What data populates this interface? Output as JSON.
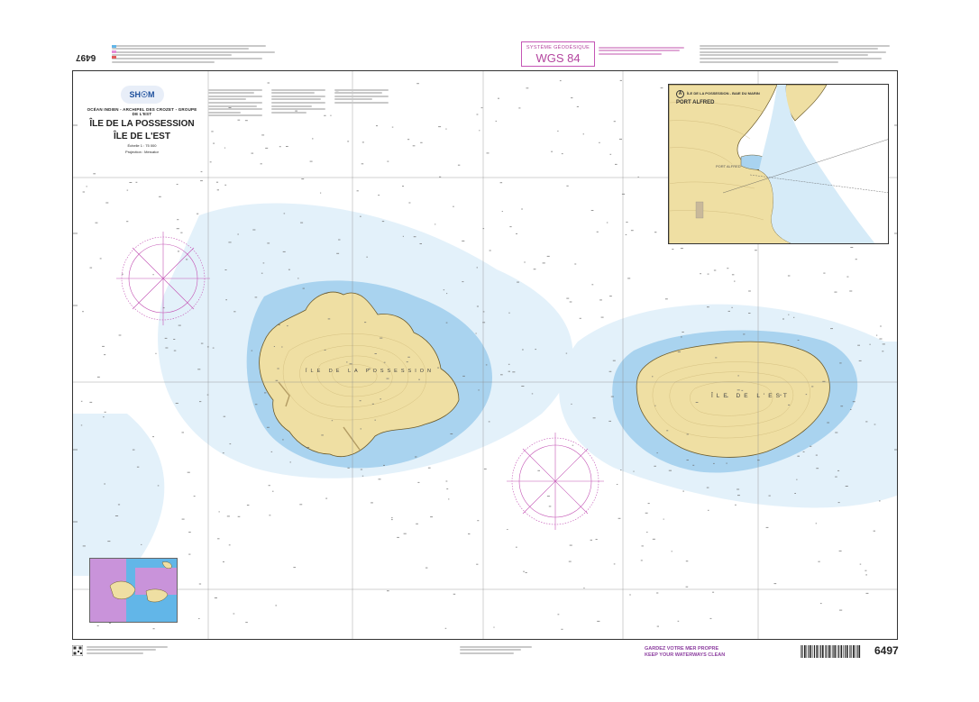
{
  "chart_number": "6497",
  "chart_number_rotated": "6497",
  "title": {
    "region": "OCÉAN INDIEN - ARCHIPEL DES CROZET - GROUPE DE L'EST",
    "line1": "ÎLE DE LA POSSESSION",
    "line2": "ÎLE DE L'EST",
    "scale": "Échelle 1 : 75 000",
    "projection": "Projection : Mercator"
  },
  "logo_text": "SH☉M",
  "geodetic": {
    "system_label": "SYSTÈME GÉODÉSIQUE",
    "value": "WGS 84"
  },
  "islands": {
    "possession_label": "ÎLE DE LA POSSESSION",
    "est_label": "ÎLE DE L'EST"
  },
  "inset": {
    "letter": "A",
    "header": "ÎLE DE LA POSSESSION - BAIE DU MARIN",
    "name": "PORT ALFRED",
    "place": "PORT ALFRED"
  },
  "footer": {
    "keep_fr": "GARDEZ VOTRE MER PROPRE",
    "keep_en": "KEEP YOUR WATERWAYS CLEAN",
    "number": "6497"
  },
  "colors": {
    "land": "#efdfa3",
    "shallow_water": "#a8d2ef",
    "mid_water": "#d6ebf8",
    "deep_water": "#ffffff",
    "magenta": "#c455b5",
    "grid": "#7a7a7a"
  }
}
